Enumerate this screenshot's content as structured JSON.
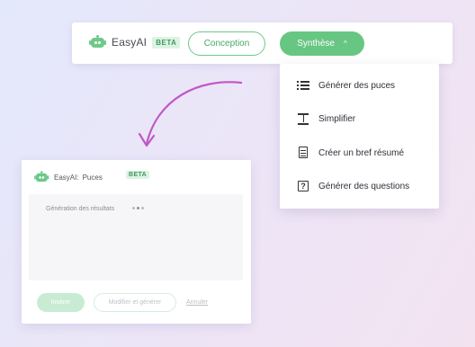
{
  "toolbar": {
    "brand_name": "EasyAI",
    "beta_label": "BETA",
    "conception_label": "Conception",
    "synthese_label": "Synthèse",
    "synthese_caret": "^"
  },
  "dropdown": {
    "items": [
      {
        "label": "Générer des puces",
        "icon": "bullet-list-icon"
      },
      {
        "label": "Simplifier",
        "icon": "simplify-icon"
      },
      {
        "label": "Créer un bref résumé",
        "icon": "document-icon"
      },
      {
        "label": "Générer des questions",
        "icon": "question-box-icon"
      }
    ]
  },
  "panel": {
    "title": "EasyAI:",
    "mode": "Puces",
    "beta_label": "BETA",
    "result_text": "Génération des résultats",
    "insert_label": "Insérer",
    "modify_label": "Modifier et générer",
    "cancel_label": "Annuler"
  },
  "colors": {
    "accent_green": "#68c683",
    "arrow_purple": "#c157c8"
  }
}
